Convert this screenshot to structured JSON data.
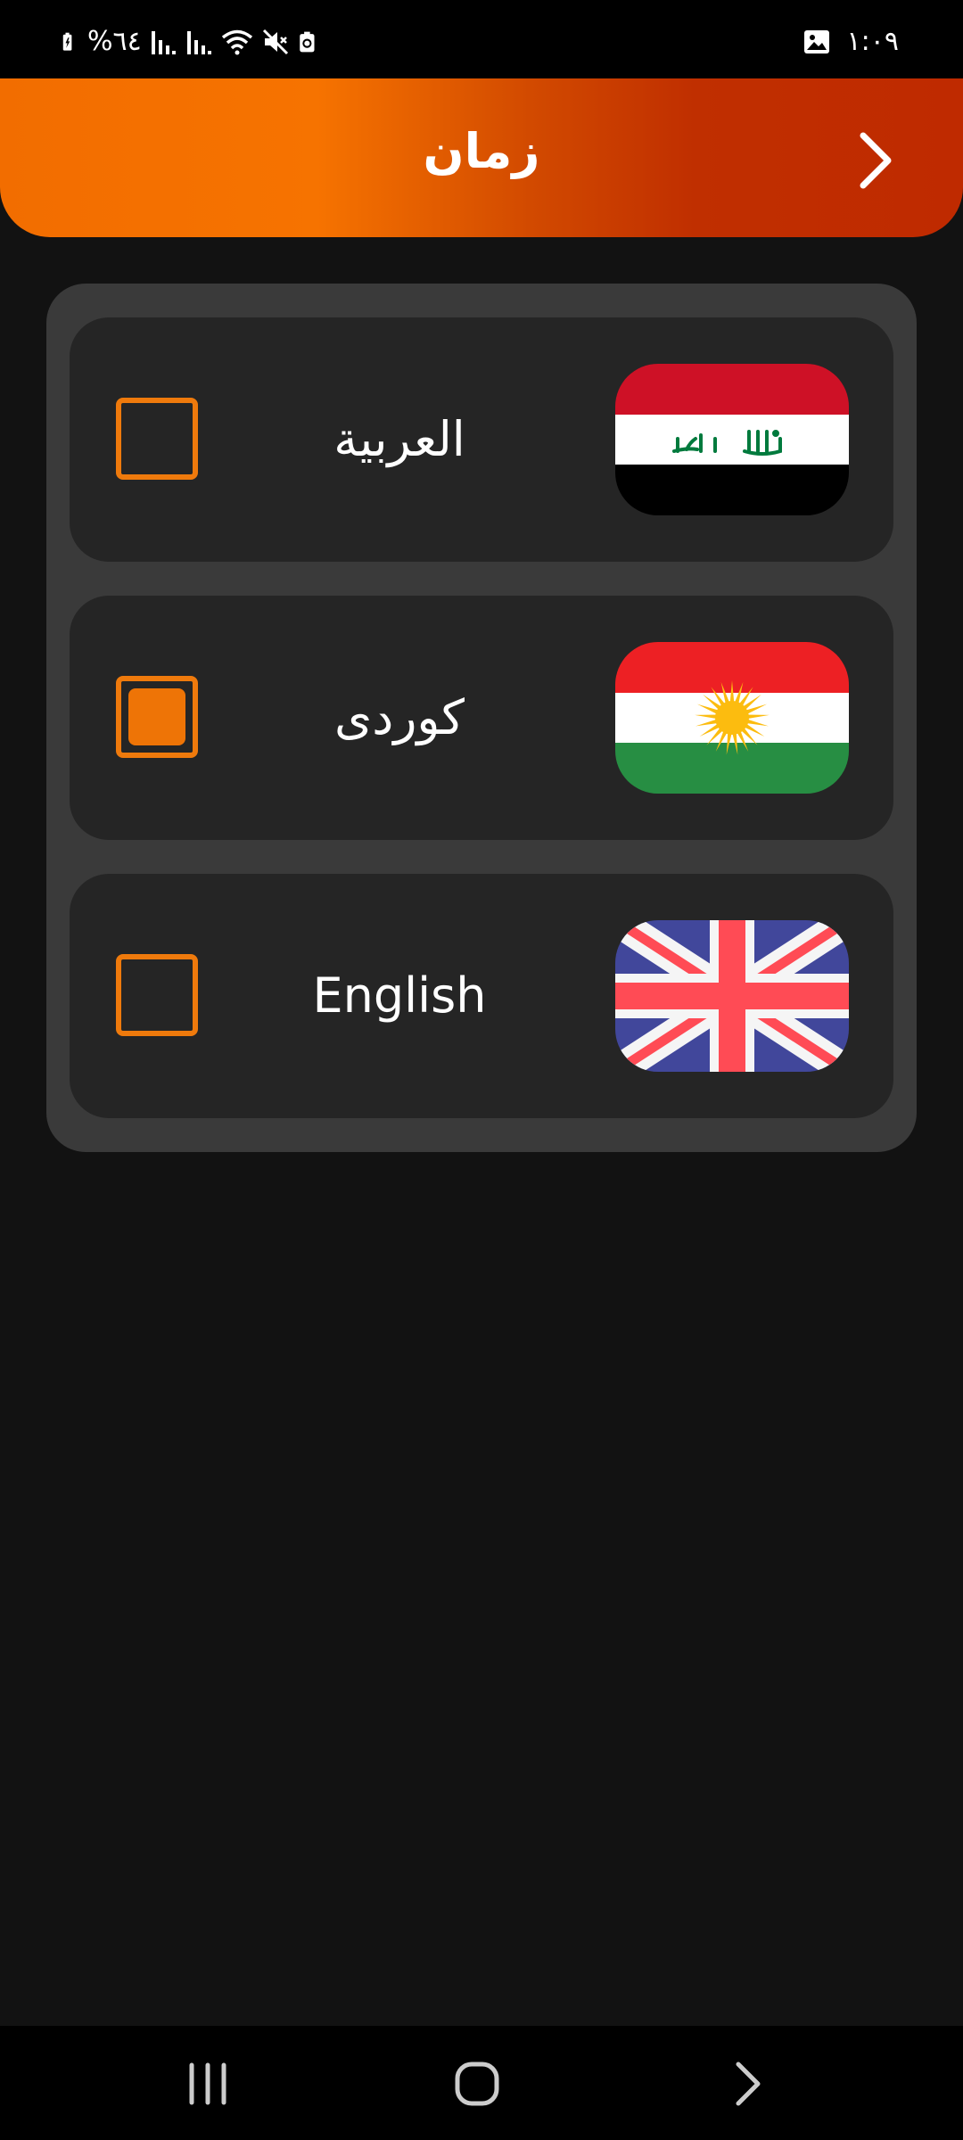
{
  "status_bar": {
    "battery": "%٦٤",
    "time": "١:٠٩",
    "icons": [
      "battery-charging-icon",
      "signal-icon",
      "signal-icon",
      "wifi-icon",
      "mute-icon",
      "battery-saver-icon",
      "gallery-icon"
    ]
  },
  "header": {
    "title": "زمان",
    "back_icon": "chevron-right-icon",
    "gradient": [
      "#f26d00",
      "#f67300",
      "#d24a00",
      "#c02f00",
      "#bf2a00"
    ]
  },
  "languages": [
    {
      "label": "العربية",
      "flag": "iraq-flag",
      "selected": false
    },
    {
      "label": "کوردی",
      "flag": "kurdistan-flag",
      "selected": true
    },
    {
      "label": "English",
      "flag": "uk-flag",
      "selected": false
    }
  ],
  "colors": {
    "accent": "#ef7a0c",
    "background": "#121212",
    "panel": "#3a3a3a",
    "row": "#252525"
  },
  "nav_bar": {
    "icons": [
      "recent-apps-icon",
      "home-icon",
      "back-icon"
    ]
  }
}
